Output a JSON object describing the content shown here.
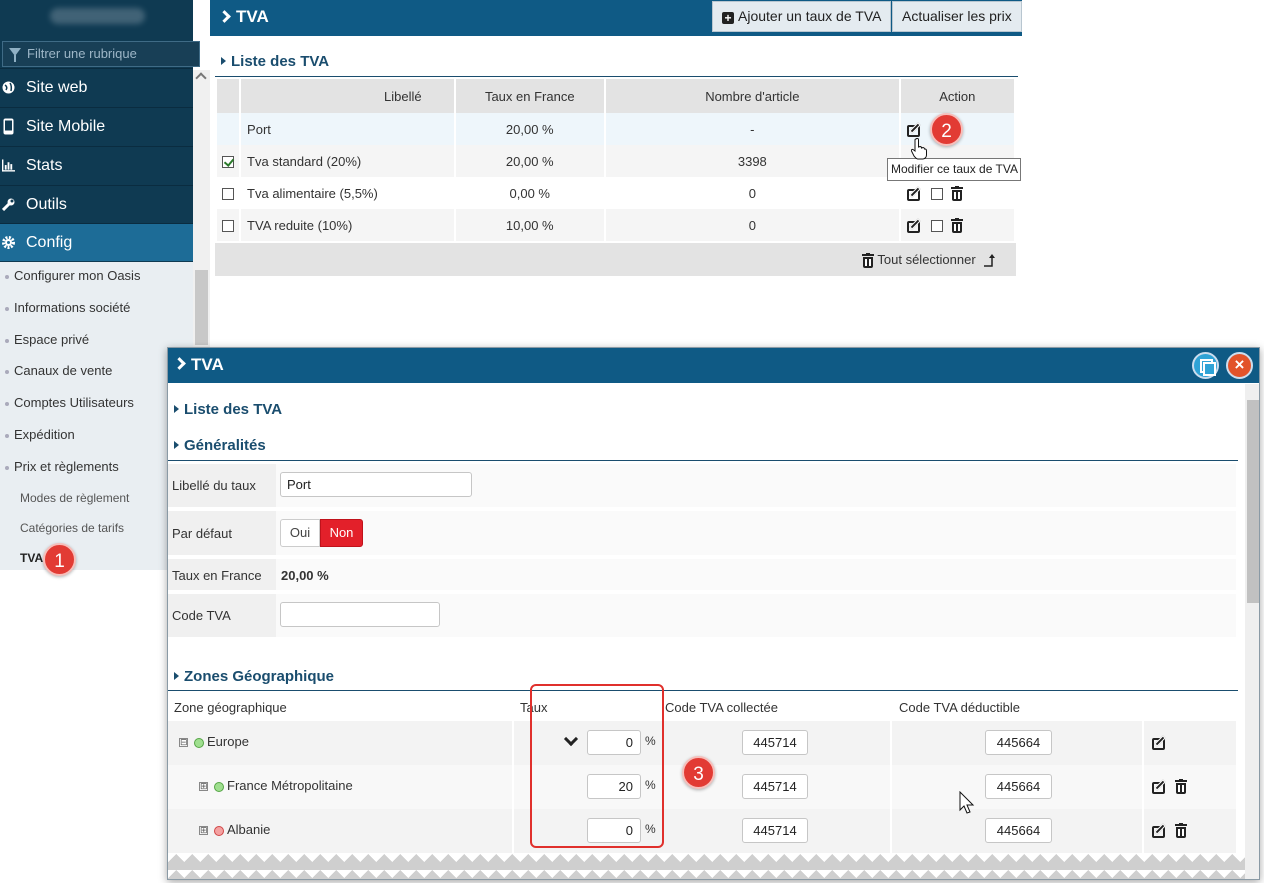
{
  "sidebar": {
    "filter_placeholder": "Filtrer une rubrique",
    "items": [
      {
        "label": "Site web"
      },
      {
        "label": "Site Mobile"
      },
      {
        "label": "Stats"
      },
      {
        "label": "Outils"
      },
      {
        "label": "Config"
      }
    ],
    "config_items": [
      "Configurer mon Oasis",
      "Informations société",
      "Espace privé",
      "Canaux de vente",
      "Comptes Utilisateurs",
      "Expédition",
      "Prix et règlements"
    ],
    "prix_subitems": [
      "Modes de règlement",
      "Catégories de tarifs",
      "TVA"
    ]
  },
  "badges": [
    "1",
    "2",
    "3"
  ],
  "main": {
    "title": "TVA",
    "add_button": "Ajouter un taux de TVA",
    "refresh_button": "Actualiser les prix",
    "section_title": "Liste des TVA",
    "columns": [
      "Libellé",
      "Taux en France",
      "Nombre d'article",
      "Action"
    ],
    "rows": [
      {
        "label": "Port",
        "rate": "20,00 %",
        "count": "-",
        "checked": false
      },
      {
        "label": "Tva standard (20%)",
        "rate": "20,00 %",
        "count": "3398",
        "checked": true
      },
      {
        "label": "Tva alimentaire (5,5%)",
        "rate": "0,00 %",
        "count": "0",
        "checked": false
      },
      {
        "label": "TVA reduite (10%)",
        "rate": "10,00 %",
        "count": "0",
        "checked": false
      }
    ],
    "select_all": "Tout sélectionner",
    "tooltip": "Modifier ce taux de TVA"
  },
  "modal": {
    "title": "TVA",
    "section_list": "Liste des TVA",
    "section_general": "Généralités",
    "label_libelle": "Libellé du taux",
    "value_libelle": "Port",
    "label_default": "Par défaut",
    "toggle_oui": "Oui",
    "toggle_non": "Non",
    "label_taux_france": "Taux en France",
    "value_taux_france": "20,00 %",
    "label_code_tva": "Code TVA",
    "value_code_tva": "",
    "section_zones": "Zones Géographique",
    "zone_columns": [
      "Zone géographique",
      "Taux",
      "Code TVA collectée",
      "Code TVA déductible"
    ],
    "zones": [
      {
        "name": "Europe",
        "taux": "0",
        "collectee": "445714",
        "deductible": "445664",
        "status": "green",
        "tree": "⊟"
      },
      {
        "name": "France Métropolitaine",
        "taux": "20",
        "collectee": "445714",
        "deductible": "445664",
        "status": "green",
        "tree": "⊞"
      },
      {
        "name": "Albanie",
        "taux": "0",
        "collectee": "445714",
        "deductible": "445664",
        "status": "red",
        "tree": "⊞"
      }
    ],
    "percent": "%",
    "close_glyph": "×"
  },
  "colors": {
    "header_blue": "#0f5a85",
    "sidebar_dark": "#0f3a52",
    "active_blue": "#1d6c97",
    "accent_red": "#e3202a",
    "badge_red": "#e23b34"
  }
}
